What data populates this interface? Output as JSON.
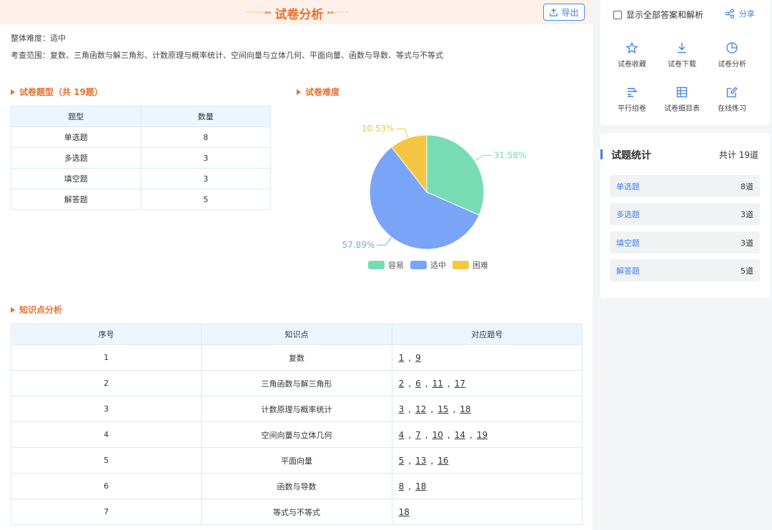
{
  "header": {
    "title": "试卷分析",
    "deco_left": "·········◂◂",
    "deco_right": "▸▸·······",
    "export_label": "导出"
  },
  "meta": {
    "difficulty_line": "整体难度：适中",
    "scope_line": "考查范围：复数、三角函数与解三角形、计数原理与概率统计、空间向量与立体几何、平面向量、函数与导数、等式与不等式"
  },
  "question_types": {
    "heading": "试卷题型（共 19题）",
    "columns": [
      "题型",
      "数量"
    ],
    "rows": [
      {
        "type": "单选题",
        "count": "8"
      },
      {
        "type": "多选题",
        "count": "3"
      },
      {
        "type": "填空题",
        "count": "3"
      },
      {
        "type": "解答题",
        "count": "5"
      }
    ]
  },
  "difficulty": {
    "heading": "试卷难度"
  },
  "chart_data": {
    "type": "pie",
    "title": "",
    "slices": [
      {
        "name": "容易",
        "value": 31.58,
        "label": "31.58%",
        "color": "#77dcb4"
      },
      {
        "name": "适中",
        "value": 57.89,
        "label": "57.89%",
        "color": "#7aa4f5"
      },
      {
        "name": "困难",
        "value": 10.53,
        "label": "10.53%",
        "color": "#f6c642"
      }
    ],
    "legend_position": "bottom"
  },
  "knowledge": {
    "heading": "知识点分析",
    "columns": [
      "序号",
      "知识点",
      "对应题号"
    ],
    "rows": [
      {
        "idx": "1",
        "name": "复数",
        "questions": [
          "1",
          "9"
        ]
      },
      {
        "idx": "2",
        "name": "三角函数与解三角形",
        "questions": [
          "2",
          "6",
          "11",
          "17"
        ]
      },
      {
        "idx": "3",
        "name": "计数原理与概率统计",
        "questions": [
          "3",
          "12",
          "15",
          "18"
        ]
      },
      {
        "idx": "4",
        "name": "空间向量与立体几何",
        "questions": [
          "4",
          "7",
          "10",
          "14",
          "19"
        ]
      },
      {
        "idx": "5",
        "name": "平面向量",
        "questions": [
          "5",
          "13",
          "16"
        ]
      },
      {
        "idx": "6",
        "name": "函数与导数",
        "questions": [
          "8",
          "18"
        ]
      },
      {
        "idx": "7",
        "name": "等式与不等式",
        "questions": [
          "18"
        ]
      }
    ]
  },
  "sidebar": {
    "show_all_label": "显示全部答案和解析",
    "share_label": "分享",
    "tools": [
      {
        "label": "试卷收藏",
        "icon": "star-icon"
      },
      {
        "label": "试卷下载",
        "icon": "download-icon"
      },
      {
        "label": "试卷分析",
        "icon": "pie-chart-icon"
      },
      {
        "label": "平行组卷",
        "icon": "parallel-paper-icon"
      },
      {
        "label": "试卷细目表",
        "icon": "table-icon"
      },
      {
        "label": "在线练习",
        "icon": "edit-icon"
      }
    ],
    "stats": {
      "title": "试题统计",
      "total": "共计 19道",
      "rows": [
        {
          "name": "单选题",
          "count": "8道"
        },
        {
          "name": "多选题",
          "count": "3道"
        },
        {
          "name": "填空题",
          "count": "3道"
        },
        {
          "name": "解答题",
          "count": "5道"
        }
      ]
    }
  },
  "colors": {
    "accent_orange": "#e8702e",
    "accent_blue": "#3f7fe8"
  }
}
